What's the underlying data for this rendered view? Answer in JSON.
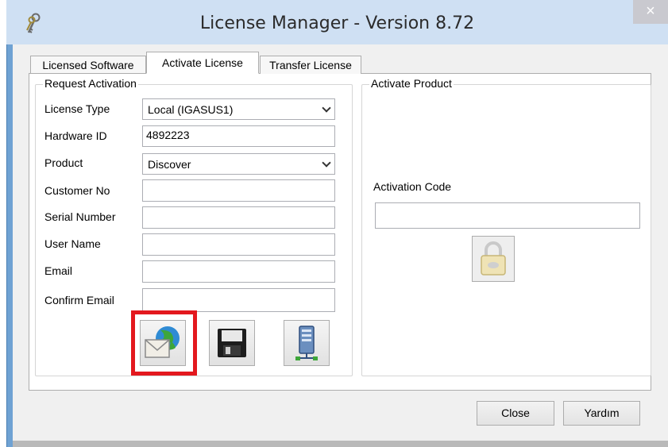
{
  "window": {
    "title": "License Manager - Version 8.72",
    "close_glyph": "×",
    "app_icon": "keys-icon",
    "frame_color": "#6fa2d3",
    "titlebar_color": "#cfe0f3"
  },
  "tabs": [
    {
      "label": "Licensed Software",
      "active": false
    },
    {
      "label": "Activate License",
      "active": true
    },
    {
      "label": "Transfer License",
      "active": false
    }
  ],
  "request_activation": {
    "title": "Request Activation",
    "license_type": {
      "label": "License Type",
      "value": "Local (IGASUS1)"
    },
    "hardware_id": {
      "label": "Hardware ID",
      "value": "4892223"
    },
    "product": {
      "label": "Product",
      "value": "Discover"
    },
    "customer_no": {
      "label": "Customer No",
      "value": ""
    },
    "serial_number": {
      "label": "Serial Number",
      "value": ""
    },
    "user_name": {
      "label": "User Name",
      "value": ""
    },
    "email": {
      "label": "Email",
      "value": ""
    },
    "confirm_email": {
      "label": "Confirm Email",
      "value": ""
    },
    "actions": [
      {
        "icon": "email-globe-icon",
        "highlighted": true
      },
      {
        "icon": "floppy-disk-icon",
        "highlighted": false
      },
      {
        "icon": "server-network-icon",
        "highlighted": false
      }
    ],
    "highlight_color": "#e3181e"
  },
  "activate_product": {
    "title": "Activate Product",
    "activation_code": {
      "label": "Activation Code",
      "value": ""
    },
    "activate_icon": "padlock-icon"
  },
  "footer": {
    "close_label": "Close",
    "help_label": "Yardım"
  }
}
